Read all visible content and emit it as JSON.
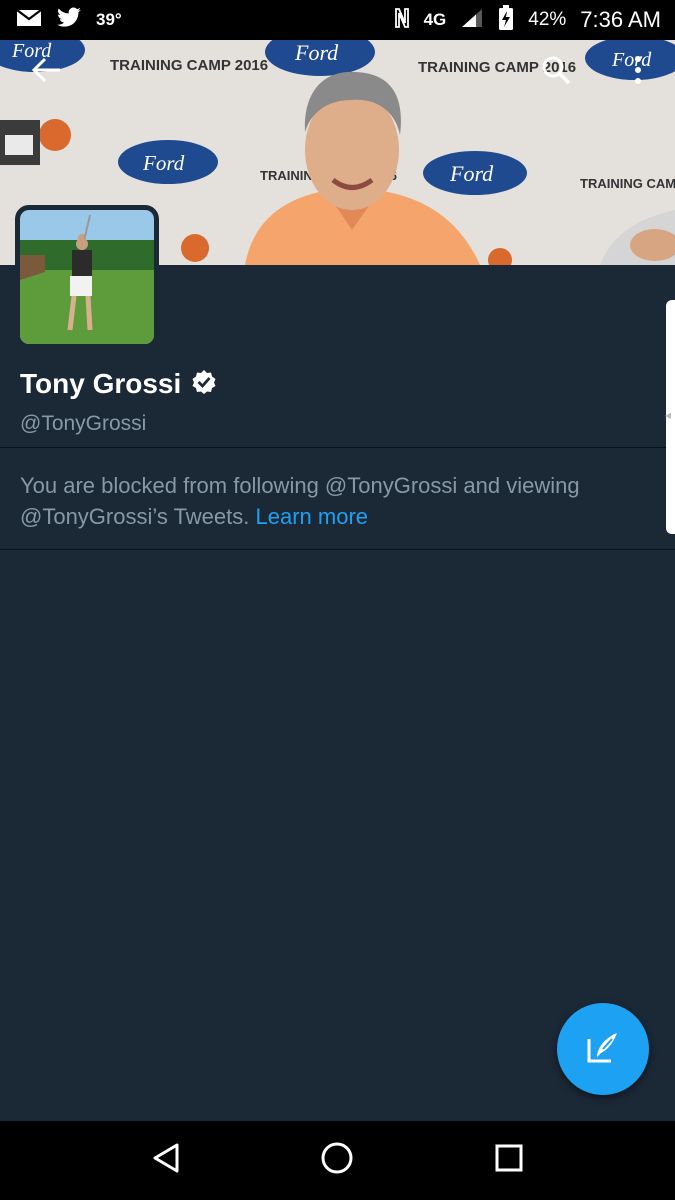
{
  "status_bar": {
    "temperature": "39°",
    "network": "4G",
    "battery": "42%",
    "time": "7:36 AM"
  },
  "icons": {
    "mail": "mail-icon",
    "twitter": "twitter-bird-icon",
    "nfc": "nfc-icon",
    "signal": "signal-icon",
    "battery": "battery-charging-icon",
    "back": "back-arrow-icon",
    "search": "search-icon",
    "overflow": "more-vertical-icon",
    "verified": "verified-badge-icon",
    "compose": "compose-tweet-icon"
  },
  "profile": {
    "name": "Tony Grossi",
    "handle": "@TonyGrossi",
    "blocked_message": "You are blocked from following @TonyGrossi and viewing @TonyGrossi’s Tweets.",
    "learn_more": "Learn more"
  },
  "banner_text": {
    "sponsor": "Ford",
    "event": "TRAINING CAMP 2016"
  },
  "colors": {
    "background": "#1b2836",
    "accent": "#1da1f2",
    "secondary_text": "#8899a6"
  }
}
